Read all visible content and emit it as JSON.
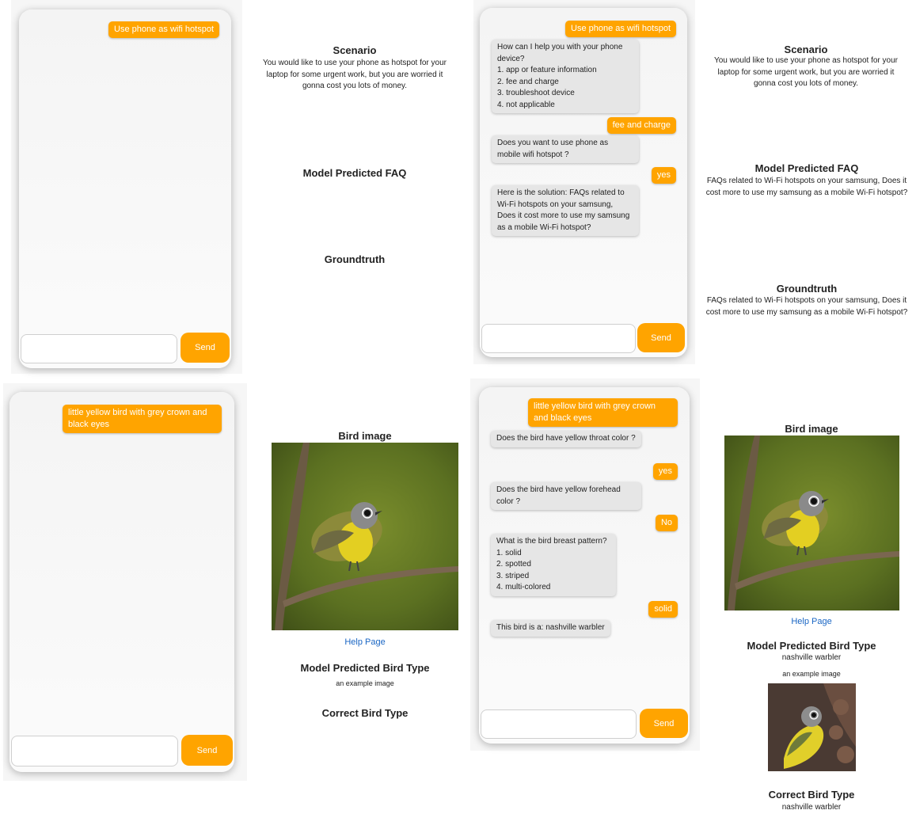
{
  "panel1": {
    "user_msg": "Use phone as wifi hotspot",
    "send_label": "Send",
    "scenario_title": "Scenario",
    "scenario_text": "You would like to use your phone as hotspot for your laptop for some urgent work, but you are worried it gonna cost you lots of money.",
    "model_title": "Model Predicted FAQ",
    "ground_title": "Groundtruth"
  },
  "panel2": {
    "msgs": [
      "Use phone as wifi hotspot",
      "How can I help you with your phone device?\n1. app or feature information\n2. fee and charge\n3. troubleshoot device\n4. not applicable",
      "fee and charge",
      "Does you want to use phone as mobile wifi hotspot ?",
      "yes",
      "Here is the solution: FAQs related to Wi-Fi hotspots on your samsung, Does it cost more to use my samsung as a mobile Wi-Fi hotspot?"
    ],
    "send_label": "Send",
    "scenario_title": "Scenario",
    "scenario_text": "You would like to use your phone as hotspot for your laptop for some urgent work, but you are worried it gonna cost you lots of money.",
    "model_title": "Model Predicted FAQ",
    "model_text": "FAQs related to Wi-Fi hotspots on your samsung, Does it cost more to use my samsung as a mobile Wi-Fi hotspot?",
    "ground_title": "Groundtruth",
    "ground_text": "FAQs related to Wi-Fi hotspots on your samsung, Does it cost more to use my samsung as a mobile Wi-Fi hotspot?"
  },
  "panel3": {
    "user_msg": "little yellow bird with grey crown and black eyes",
    "send_label": "Send",
    "bird_title": "Bird image",
    "help_link": "Help Page",
    "model_title": "Model Predicted Bird Type",
    "example_text": "an example image",
    "correct_title": "Correct Bird Type"
  },
  "panel4": {
    "msgs": [
      "little yellow bird with grey crown and black eyes",
      "Does the bird have yellow throat color ?",
      "yes",
      "Does the bird have yellow forehead color ?",
      "No",
      "What is the bird breast pattern?\n1. solid\n2. spotted\n3. striped\n4. multi-colored",
      "solid",
      "This bird is a: nashville warbler"
    ],
    "send_label": "Send",
    "bird_title": "Bird image",
    "help_link": "Help Page",
    "model_title": "Model Predicted Bird Type",
    "model_value": "nashville warbler",
    "example_text": "an example image",
    "correct_title": "Correct Bird Type",
    "correct_value": "nashville warbler"
  },
  "colors": {
    "accent": "#ffa400",
    "bot_bubble": "#e6e6e6",
    "link": "#1a66c4"
  }
}
